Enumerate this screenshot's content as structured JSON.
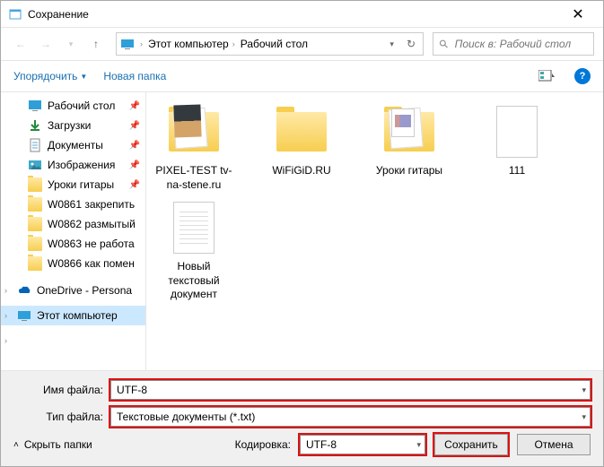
{
  "title": "Сохранение",
  "breadcrumb": {
    "pc": "Этот компьютер",
    "desktop": "Рабочий стол"
  },
  "search": {
    "placeholder": "Поиск в: Рабочий стол"
  },
  "toolbar": {
    "organize": "Упорядочить",
    "newfolder": "Новая папка"
  },
  "sidebar": {
    "items": [
      {
        "label": "Рабочий стол",
        "icon": "desktop",
        "pinned": true
      },
      {
        "label": "Загрузки",
        "icon": "download",
        "pinned": true
      },
      {
        "label": "Документы",
        "icon": "document",
        "pinned": true
      },
      {
        "label": "Изображения",
        "icon": "pictures",
        "pinned": true
      },
      {
        "label": "Уроки гитары",
        "icon": "folder",
        "pinned": true
      },
      {
        "label": "W0861 закрепить",
        "icon": "folder"
      },
      {
        "label": "W0862 размытый",
        "icon": "folder"
      },
      {
        "label": "W0863 не работа",
        "icon": "folder"
      },
      {
        "label": "W0866 как помен",
        "icon": "folder"
      }
    ],
    "onedrive": "OneDrive - Persona",
    "thispc": "Этот компьютер"
  },
  "content": {
    "items": [
      {
        "label": "PIXEL-TEST tv-na-stene.ru",
        "type": "folder-dark"
      },
      {
        "label": "WiFiGiD.RU",
        "type": "folder"
      },
      {
        "label": "Уроки гитары",
        "type": "folder-thumb"
      },
      {
        "label": "111",
        "type": "doc"
      },
      {
        "label": "Новый текстовый документ",
        "type": "doc-lines"
      }
    ]
  },
  "fields": {
    "filename_label": "Имя файла:",
    "filename_value": "UTF-8",
    "filetype_label": "Тип файла:",
    "filetype_value": "Текстовые документы (*.txt)"
  },
  "footer": {
    "hide": "Скрыть папки",
    "encoding_label": "Кодировка:",
    "encoding_value": "UTF-8",
    "save": "Сохранить",
    "cancel": "Отмена"
  }
}
